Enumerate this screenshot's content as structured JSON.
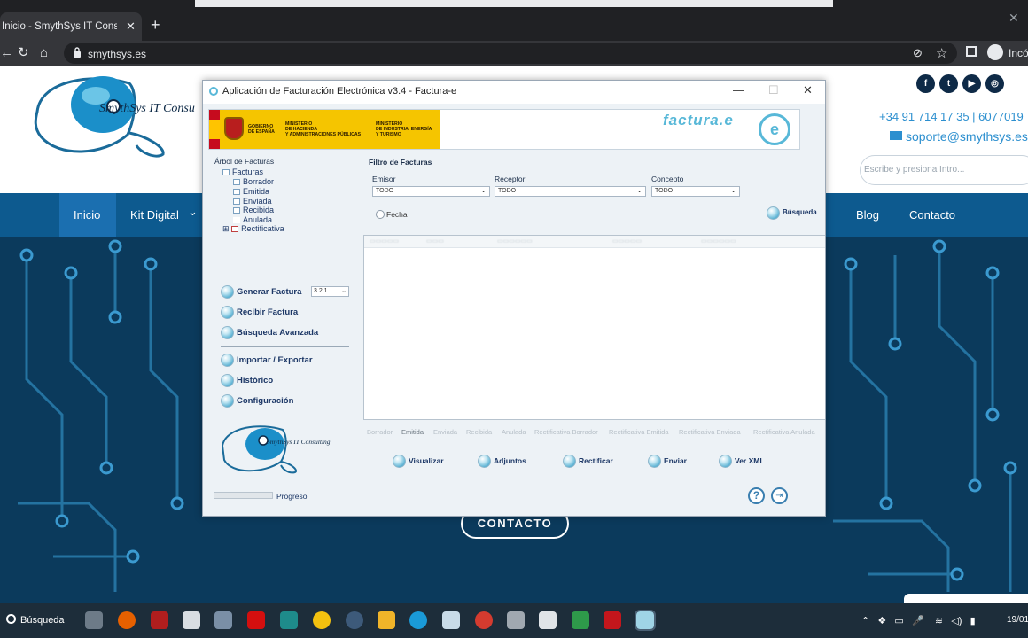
{
  "browser": {
    "tab_title": "Inicio - SmythSys IT Consulting. C",
    "tab_close": "✕",
    "new_tab": "+",
    "url": "smythsys.es",
    "profile_label": "Incó",
    "win_min": "—",
    "win_max": "✕"
  },
  "site": {
    "logo_text": "SmythSys IT Consu",
    "phone": "+34 91 714 17 35 | 6077019",
    "email": "soporte@smythsys.es",
    "search_placeholder": "Escribe y presiona Intro...",
    "nav": {
      "inicio": "Inicio",
      "kit_digital": "Kit Digital",
      "kit_chevron": "⌄",
      "blog": "Blog",
      "contacto": "Contacto"
    },
    "social": [
      "f",
      "t",
      "▶",
      "◎"
    ],
    "contacto_button": "CONTACTO"
  },
  "app": {
    "title": "Aplicación de Facturación Electrónica v3.4 - Factura-e",
    "win_min": "—",
    "win_max": "☐",
    "win_close": "✕",
    "banner": {
      "gov_line1": "GOBIERNO",
      "gov_line2": "DE ESPAÑA",
      "min1_line1": "MINISTERIO",
      "min1_line2": "DE HACIENDA",
      "min1_line3": "Y ADMINISTRACIONES PÚBLICAS",
      "min2_line1": "MINISTERIO",
      "min2_line2": "DE INDUSTRIA, ENERGÍA",
      "min2_line3": "Y TURISMO",
      "product_logo": "factura.e",
      "product_icon": "e"
    },
    "tree": {
      "title": "Árbol de Facturas",
      "root": "Facturas",
      "items": [
        "Borrador",
        "Emitida",
        "Enviada",
        "Recibida",
        "Anulada"
      ],
      "expandable": "Rectificativa",
      "expand_glyph": "⊞"
    },
    "actions": {
      "generar": "Generar Factura",
      "version": "3.2.1",
      "recibir": "Recibir Factura",
      "busqueda_avanzada": "Búsqueda Avanzada",
      "importar": "Importar / Exportar",
      "historico": "Histórico",
      "configuracion": "Configuración"
    },
    "bottom_logo_text": "SmythSys IT Consulting",
    "progress_label": "Progreso",
    "progress": 0,
    "filter": {
      "title": "Filtro de Facturas",
      "emisor_label": "Emisor",
      "emisor_value": "TODO",
      "receptor_label": "Receptor",
      "receptor_value": "TODO",
      "concepto_label": "Concepto",
      "concepto_value": "TODO",
      "fecha_label": "Fecha",
      "search_button": "Búsqueda",
      "dropdown_glyph": "⌄"
    },
    "status_tabs": [
      "Borrador",
      "Emitida",
      "Enviada",
      "Recibida",
      "Anulada",
      "Rectificativa Borrador",
      "Rectificativa Emitida",
      "Rectificativa Enviada",
      "Rectificativa Anulada"
    ],
    "active_status_tab": "Emitida",
    "bottom_actions": {
      "visualizar": "Visualizar",
      "adjuntos": "Adjuntos",
      "rectificar": "Rectificar",
      "enviar": "Enviar",
      "ver_xml": "Ver XML"
    },
    "help_glyph": "?",
    "exit_glyph": "⇥"
  },
  "taskbar": {
    "search_label": "Búsqueda",
    "date": "19/01"
  },
  "colors": {
    "accent": "#58b8d8",
    "nav_blue": "#0d5a8f",
    "hero_bg": "#0b3a5c",
    "text_blue": "#1c3766"
  }
}
